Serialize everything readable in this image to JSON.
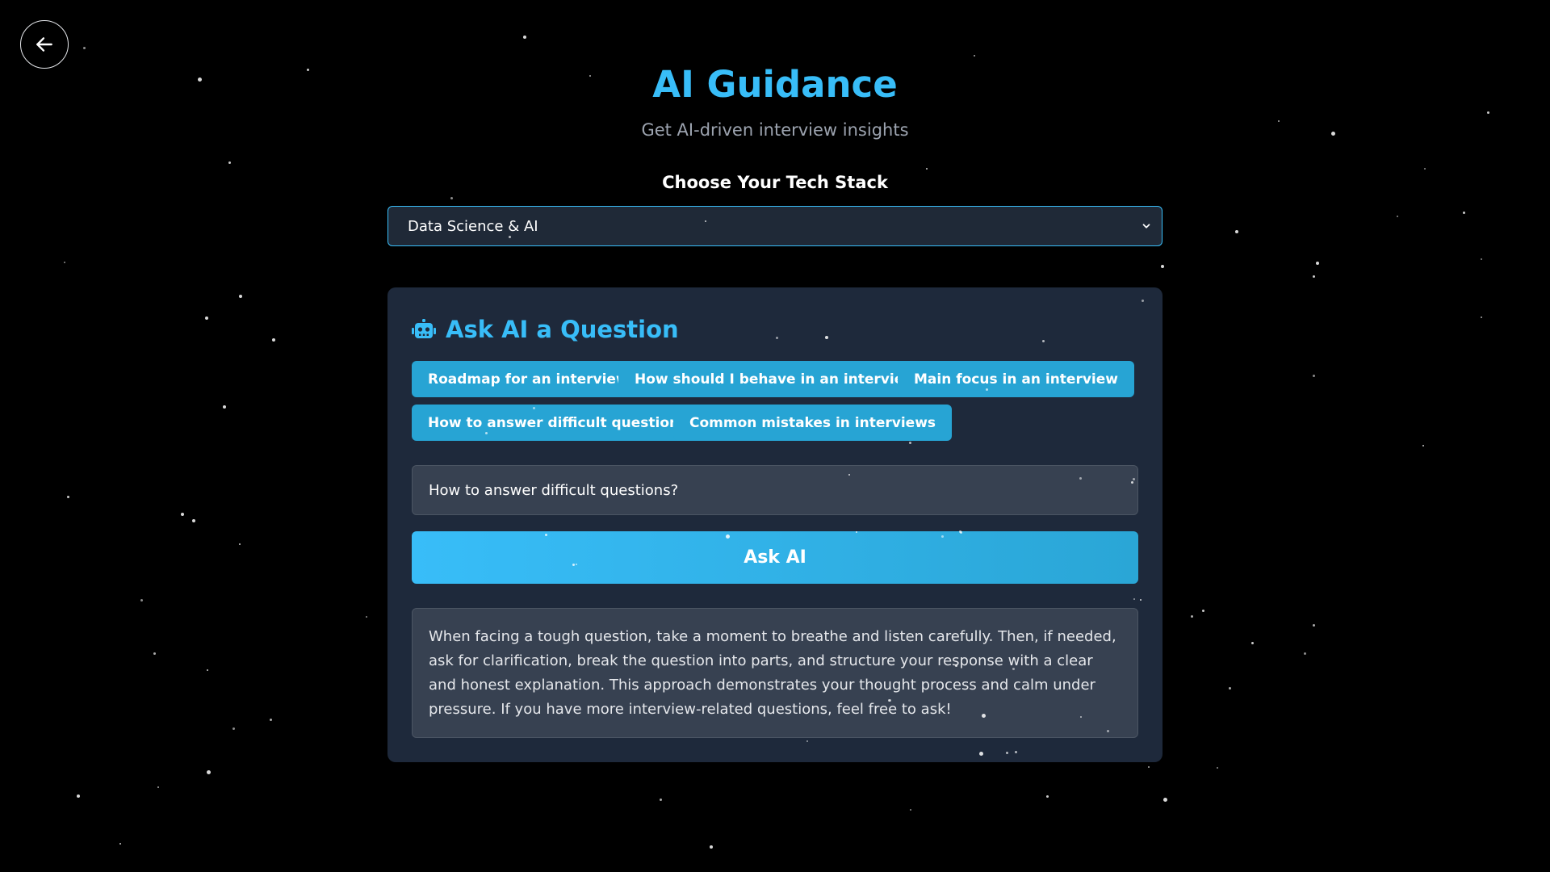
{
  "header": {
    "title": "AI Guidance",
    "subtitle": "Get AI-driven interview insights",
    "back_icon": "arrow-left-icon"
  },
  "tech_stack": {
    "label": "Choose Your Tech Stack",
    "selected": "Data Science & AI",
    "chevron_icon": "chevron-down-icon"
  },
  "ask_card": {
    "heading": "Ask AI a Question",
    "heading_icon": "robot-icon",
    "suggestions": [
      "Roadmap for an interview",
      "How should I behave in an interview?",
      "Main focus in an interview",
      "How to answer difficult questions?",
      "Common mistakes in interviews"
    ],
    "input_value": "How to answer difficult questions?",
    "ask_button_label": "Ask AI",
    "answer": "When facing a tough question, take a moment to breathe and listen carefully. Then, if needed, ask for clarification, break the question into parts, and structure your response with a clear and honest explanation. This approach demonstrates your thought process and calm under pressure. If you have more interview-related questions, feel free to ask!"
  },
  "colors": {
    "background": "#000000",
    "accent": "#38bdf8",
    "card": "#1e293b",
    "chip": "#27a4d4",
    "input": "#374151"
  }
}
